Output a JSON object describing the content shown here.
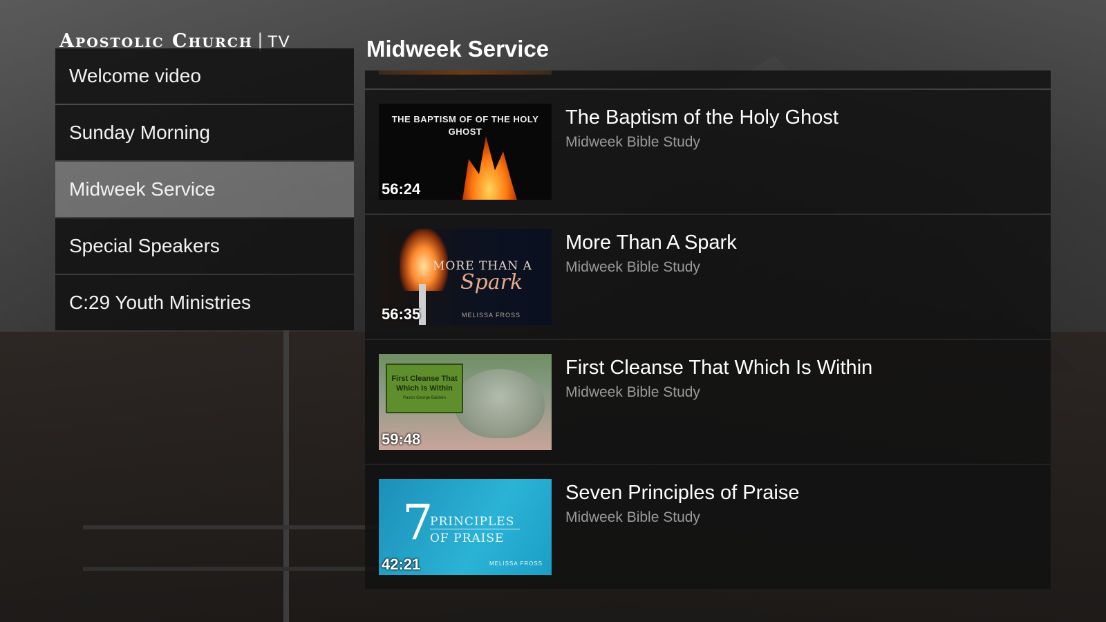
{
  "app": {
    "logo_main": "Apostolic Church",
    "logo_separator": "|",
    "logo_suffix": "TV"
  },
  "sidebar": {
    "items": [
      {
        "label": "Welcome video",
        "active": false
      },
      {
        "label": "Sunday Morning",
        "active": false
      },
      {
        "label": "Midweek Service",
        "active": true
      },
      {
        "label": "Special Speakers",
        "active": false
      },
      {
        "label": "C:29 Youth Ministries",
        "active": false
      }
    ]
  },
  "main": {
    "section_title": "Midweek Service",
    "videos": [
      {
        "title": "The Baptism of the Holy Ghost",
        "subtitle": "Midweek Bible Study",
        "duration": "56:24",
        "thumb_text": "THE BAPTISM OF OF THE HOLY GHOST"
      },
      {
        "title": "More Than A Spark",
        "subtitle": "Midweek Bible Study",
        "duration": "56:35",
        "thumb_text": "MORE THAN A",
        "thumb_script": "Spark",
        "thumb_author": "MELISSA FROSS"
      },
      {
        "title": "First Cleanse That Which Is Within",
        "subtitle": "Midweek Bible Study",
        "duration": "59:48",
        "thumb_text": "First Cleanse That Which Is Within",
        "thumb_author": "Pastor George Baldwin"
      },
      {
        "title": "Seven Principles of Praise",
        "subtitle": "Midweek Bible Study",
        "duration": "42:21",
        "thumb_number": "7",
        "thumb_line1": "PRINCIPLES",
        "thumb_line2": "OF PRAISE",
        "thumb_author": "MELISSA FROSS"
      }
    ]
  },
  "colors": {
    "active_item_bg": "#8a8a8a",
    "panel_bg": "#121212",
    "subtitle_text": "#9a9a9a"
  }
}
